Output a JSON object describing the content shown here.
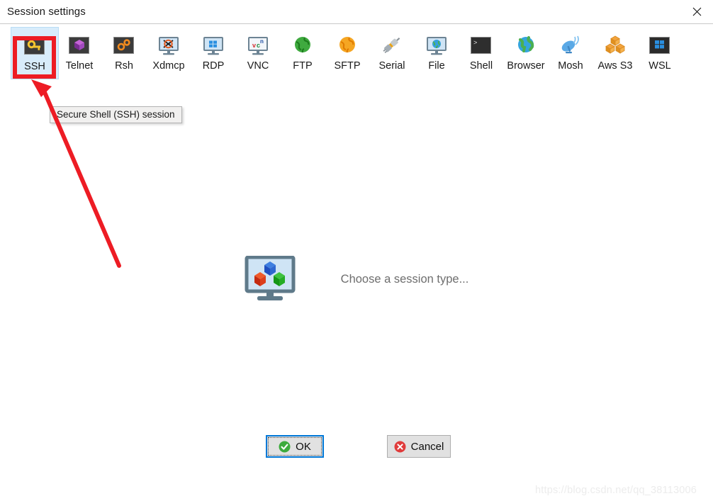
{
  "window": {
    "title": "Session settings",
    "close_icon": "close-icon"
  },
  "toolbar": {
    "items": [
      {
        "label": "SSH",
        "icon": "ssh-key-icon",
        "selected": true
      },
      {
        "label": "Telnet",
        "icon": "telnet-cube-icon",
        "selected": false
      },
      {
        "label": "Rsh",
        "icon": "rsh-gears-icon",
        "selected": false
      },
      {
        "label": "Xdmcp",
        "icon": "xdmcp-monitor-icon",
        "selected": false
      },
      {
        "label": "RDP",
        "icon": "rdp-monitor-icon",
        "selected": false
      },
      {
        "label": "VNC",
        "icon": "vnc-monitor-icon",
        "selected": false
      },
      {
        "label": "FTP",
        "icon": "ftp-globe-icon",
        "selected": false
      },
      {
        "label": "SFTP",
        "icon": "sftp-globe-icon",
        "selected": false
      },
      {
        "label": "Serial",
        "icon": "serial-plug-icon",
        "selected": false
      },
      {
        "label": "File",
        "icon": "file-monitor-icon",
        "selected": false
      },
      {
        "label": "Shell",
        "icon": "shell-terminal-icon",
        "selected": false
      },
      {
        "label": "Browser",
        "icon": "browser-globe-icon",
        "selected": false
      },
      {
        "label": "Mosh",
        "icon": "mosh-satellite-icon",
        "selected": false
      },
      {
        "label": "Aws S3",
        "icon": "aws-s3-cubes-icon",
        "selected": false
      },
      {
        "label": "WSL",
        "icon": "wsl-windows-icon",
        "selected": false
      }
    ]
  },
  "tooltip": {
    "text": "Secure Shell (SSH) session"
  },
  "main": {
    "placeholder_text": "Choose a session type...",
    "placeholder_icon": "monitor-cubes-icon"
  },
  "buttons": {
    "ok": {
      "label": "OK",
      "icon": "green-check-icon"
    },
    "cancel": {
      "label": "Cancel",
      "icon": "red-x-icon"
    }
  },
  "annotations": {
    "highlight_color": "#ED1C24",
    "arrow_color": "#ED1C24",
    "watermark": "https://blog.csdn.net/qq_38113006"
  },
  "colors": {
    "accent": "#0078d7",
    "selection": "#d8ecfb",
    "button_face": "#e1e1e1"
  }
}
